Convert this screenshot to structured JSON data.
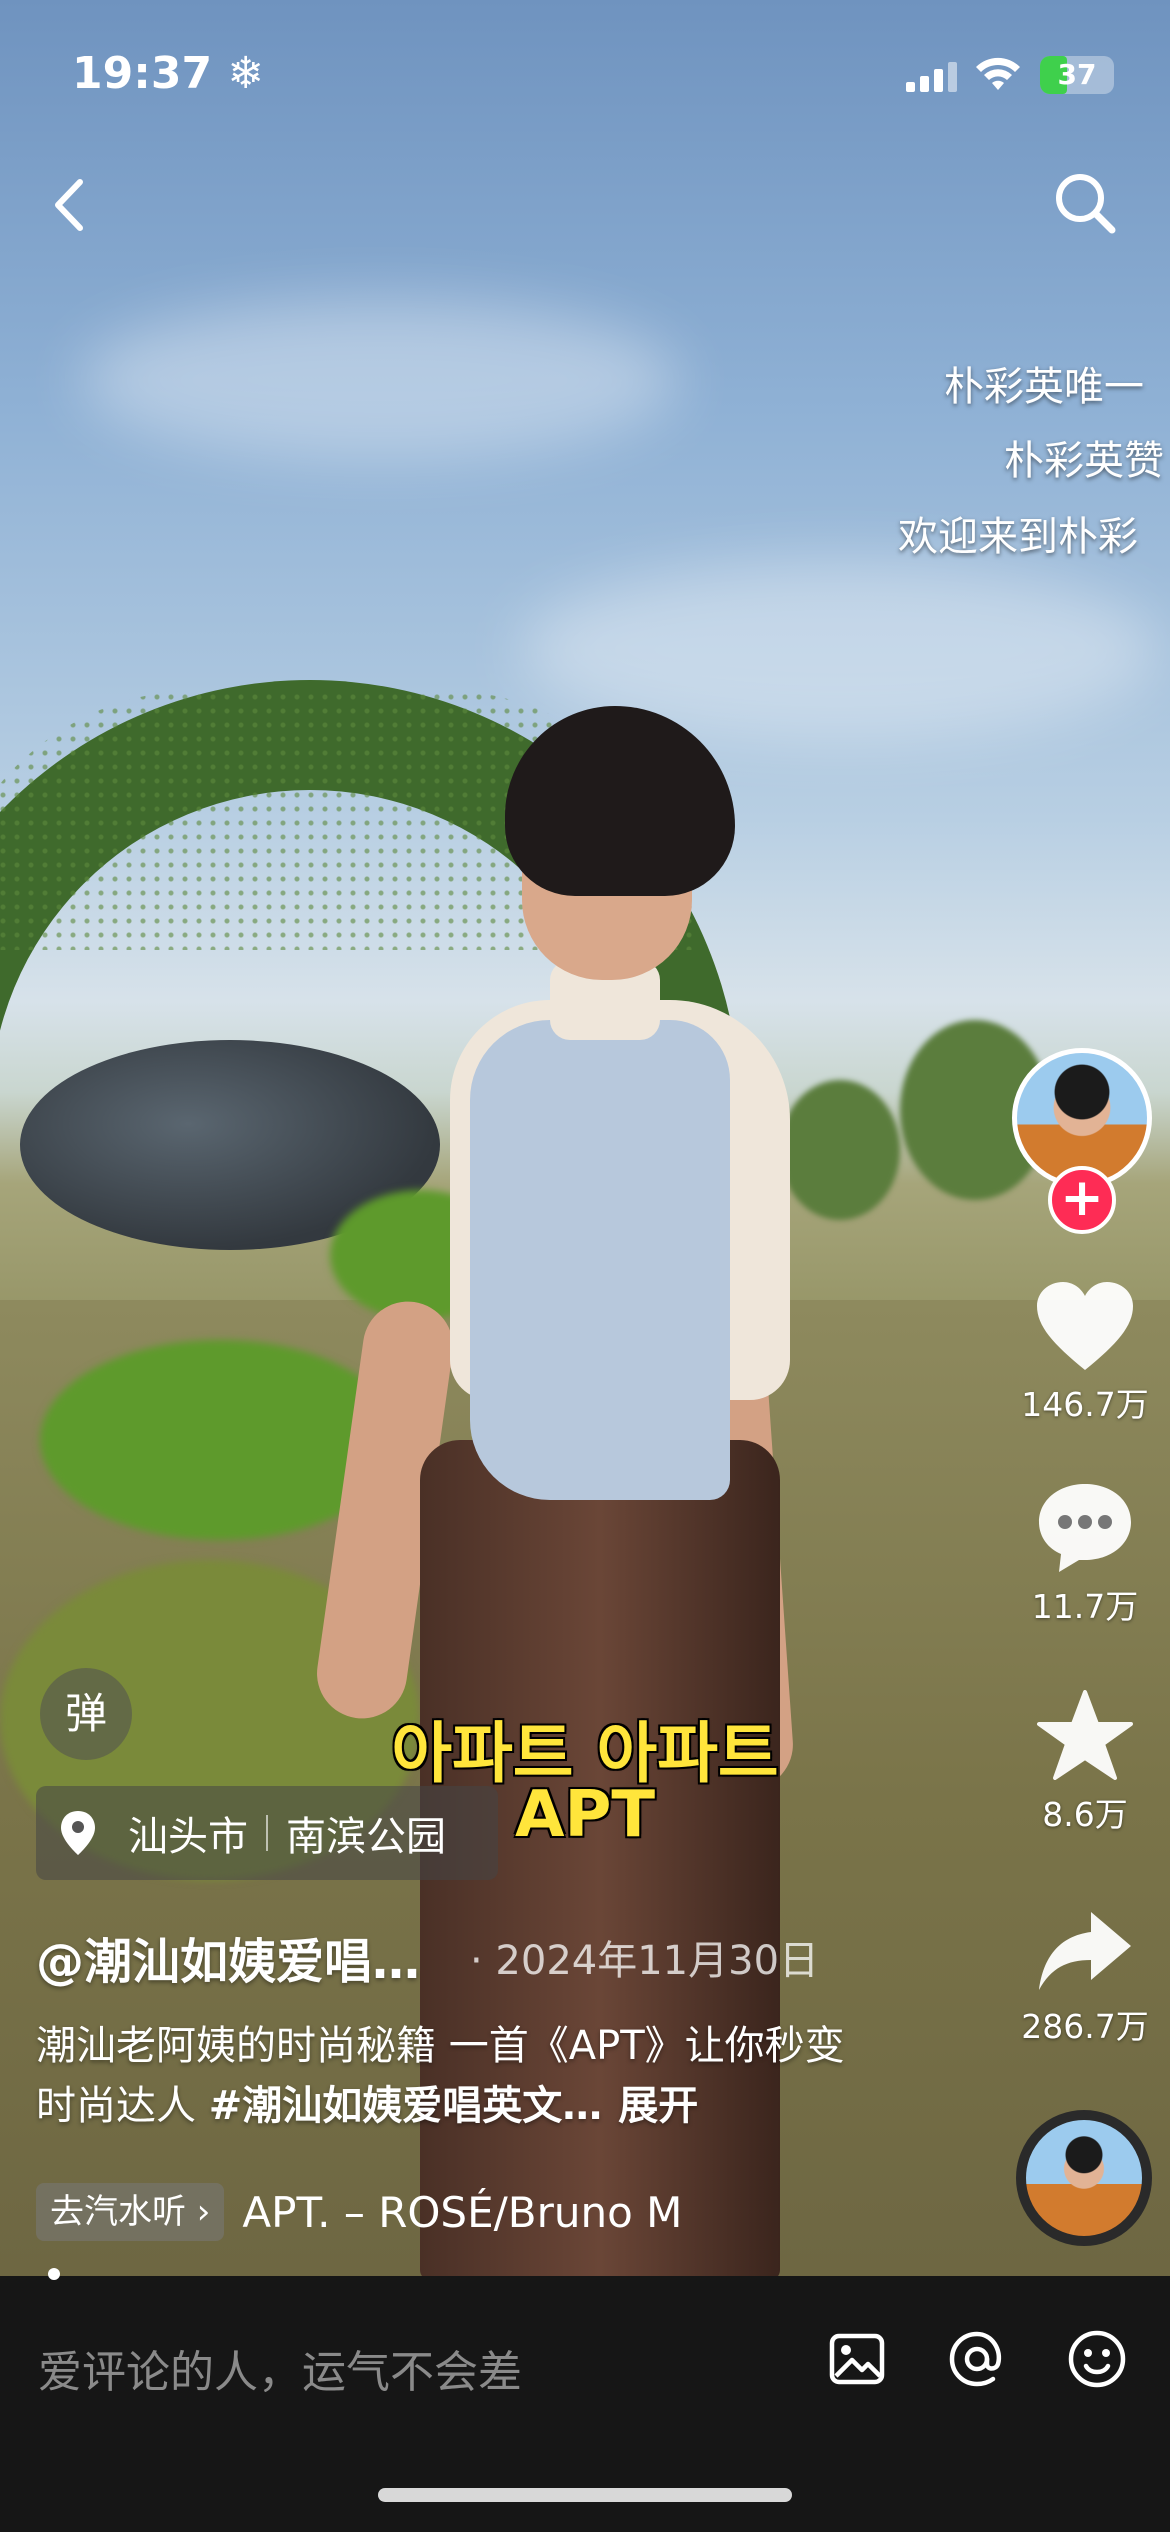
{
  "status_bar": {
    "time": "19:37 ❄",
    "battery": "37",
    "battery_level_pct": 37
  },
  "danmaku": [
    "朴彩英唯一",
    "朴彩英赞",
    "欢迎来到朴彩"
  ],
  "lyrics": {
    "line1": "아파트 아파트",
    "line2": "APT"
  },
  "actions": {
    "like_count": "146.7万",
    "comment_count": "11.7万",
    "favorite_count": "8.6万",
    "share_count": "286.7万"
  },
  "danmaku_toggle": "弹",
  "location": {
    "city": "汕头市",
    "place": "南滨公园"
  },
  "post": {
    "author": "@潮汕如姨爱唱…",
    "date": "· 2024年11月30日",
    "description": "潮汕老阿姨的时尚秘籍 一首《APT》让你秒变时尚达人 ",
    "hashtag": "#潮汕如姨爱唱英文…",
    "expand": "展开"
  },
  "music": {
    "chip": "去汽水听 ›",
    "title": "APT. – ROSÉ/Bruno M"
  },
  "comment_bar": {
    "placeholder": "爱评论的人，运气不会差"
  },
  "colors": {
    "follow": "#fe2c55",
    "lyric": "#ffe53b",
    "battery": "#3fd04c"
  }
}
